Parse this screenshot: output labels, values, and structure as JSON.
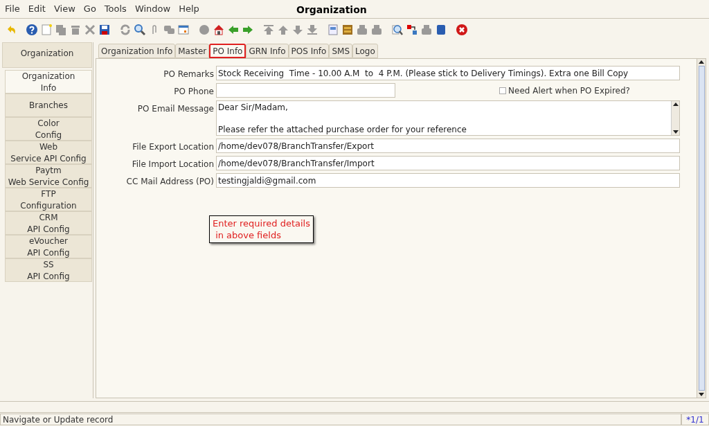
{
  "window": {
    "title": "Organization"
  },
  "menu": [
    {
      "label": "File"
    },
    {
      "label": "Edit"
    },
    {
      "label": "View"
    },
    {
      "label": "Go"
    },
    {
      "label": "Tools"
    },
    {
      "label": "Window"
    },
    {
      "label": "Help"
    }
  ],
  "toolbar": [
    {
      "kind": "undo",
      "disabled": false
    },
    {
      "kind": "gap"
    },
    {
      "kind": "help",
      "disabled": false
    },
    {
      "kind": "new",
      "disabled": false
    },
    {
      "kind": "copy",
      "disabled": true
    },
    {
      "kind": "delete",
      "disabled": true
    },
    {
      "kind": "cut",
      "disabled": true
    },
    {
      "kind": "save",
      "disabled": false
    },
    {
      "kind": "gap"
    },
    {
      "kind": "refresh",
      "disabled": true
    },
    {
      "kind": "find",
      "disabled": false
    },
    {
      "kind": "attach",
      "disabled": true
    },
    {
      "kind": "chat",
      "disabled": true
    },
    {
      "kind": "calendar",
      "disabled": false
    },
    {
      "kind": "gap"
    },
    {
      "kind": "circle",
      "disabled": true
    },
    {
      "kind": "home",
      "disabled": false
    },
    {
      "kind": "back",
      "disabled": false
    },
    {
      "kind": "forward",
      "disabled": false
    },
    {
      "kind": "gap"
    },
    {
      "kind": "first",
      "disabled": true
    },
    {
      "kind": "up",
      "disabled": true
    },
    {
      "kind": "down",
      "disabled": true
    },
    {
      "kind": "last",
      "disabled": true
    },
    {
      "kind": "gap"
    },
    {
      "kind": "document",
      "disabled": false
    },
    {
      "kind": "archive",
      "disabled": false
    },
    {
      "kind": "print",
      "disabled": true
    },
    {
      "kind": "print",
      "disabled": true
    },
    {
      "kind": "gap"
    },
    {
      "kind": "zoom",
      "disabled": false
    },
    {
      "kind": "transfer",
      "disabled": false
    },
    {
      "kind": "print",
      "disabled": true
    },
    {
      "kind": "cube",
      "disabled": false
    },
    {
      "kind": "gap"
    },
    {
      "kind": "close",
      "disabled": false
    }
  ],
  "sidebar": {
    "header": "Organization",
    "items": [
      {
        "label": "Organization\nInfo",
        "selected": true
      },
      {
        "label": "Branches",
        "selected": false
      },
      {
        "label": "Color\nConfig",
        "selected": false
      },
      {
        "label": "Web\nService API Config",
        "selected": false
      },
      {
        "label": "Paytm\nWeb Service Config",
        "selected": false
      },
      {
        "label": "FTP\nConfiguration",
        "selected": false
      },
      {
        "label": "CRM\nAPI Config",
        "selected": false
      },
      {
        "label": "eVoucher\nAPI Config",
        "selected": false
      },
      {
        "label": "SS\nAPI Config",
        "selected": false
      }
    ]
  },
  "tabs": [
    {
      "label": "Organization Info",
      "selected": false
    },
    {
      "label": "Master",
      "selected": false
    },
    {
      "label": "PO Info",
      "selected": true
    },
    {
      "label": "GRN Info",
      "selected": false
    },
    {
      "label": "POS Info",
      "selected": false
    },
    {
      "label": "SMS",
      "selected": false
    },
    {
      "label": "Logo",
      "selected": false
    }
  ],
  "form": {
    "po_remarks": {
      "label": "PO Remarks",
      "value": "Stock Receiving  Time - 10.00 A.M  to  4 P.M. (Please stick to Delivery Timings). Extra one Bill Copy"
    },
    "po_phone": {
      "label": "PO Phone"
    },
    "po_expiry_alert": {
      "label": "Need Alert when PO Expired?",
      "checked": false
    },
    "po_email_message": {
      "label": "PO Email Message",
      "value": "Dear Sir/Madam,\n\nPlease refer the attached purchase order for your reference"
    },
    "file_export_location": {
      "label": "File Export Location",
      "value": "/home/dev078/BranchTransfer/Export"
    },
    "file_import_location": {
      "label": "File Import Location",
      "value": "/home/dev078/BranchTransfer/Import"
    },
    "cc_mail_address": {
      "label": "CC Mail Address (PO)",
      "value": "testingjaldi@gmail.com"
    }
  },
  "callout": "Enter required details\n in above fields",
  "status_bar": {
    "message": "Navigate or Update record",
    "record": "*1/1"
  }
}
